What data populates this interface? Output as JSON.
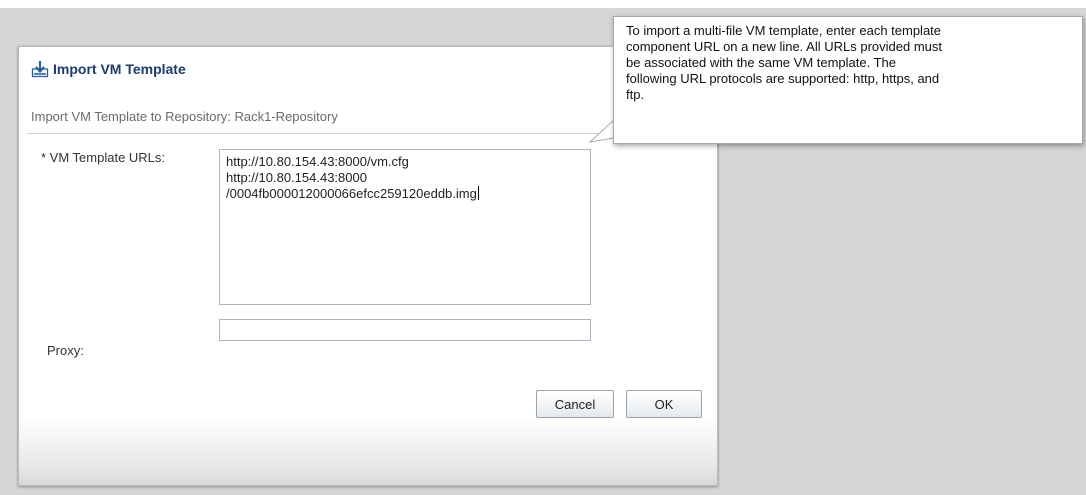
{
  "dialog": {
    "title": "Import VM Template",
    "subtitle": "Import VM Template to Repository: Rack1-Repository",
    "fields": {
      "urls_label": "* VM Template URLs:",
      "urls_lines": [
        "http://10.80.154.43:8000/vm.cfg",
        "http://10.80.154.43:8000",
        "/0004fb000012000066efcc259120eddb.img"
      ],
      "proxy_label": "Proxy:",
      "proxy_value": ""
    },
    "buttons": {
      "cancel_label": "Cancel",
      "ok_label": "OK"
    }
  },
  "tooltip": {
    "lines": [
      "To import a multi-file VM template, enter each template",
      "component URL on a new line. All URLs provided must",
      "be associated with the same VM template. The",
      "following URL protocols are supported: http, https, and",
      "ftp."
    ]
  },
  "colors": {
    "title": "#1a3c6e",
    "background": "#d6d6d6"
  },
  "icons": {
    "title_icon": "import-icon"
  }
}
